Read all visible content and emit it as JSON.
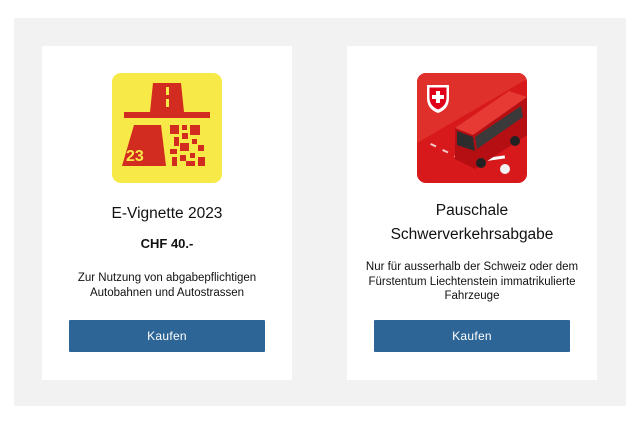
{
  "products": [
    {
      "title": "E-Vignette 2023",
      "price": "CHF 40.-",
      "description": "Zur Nutzung von abgabepflichtigen Autobahnen und Autostrassen",
      "button_label": "Kaufen",
      "icon_text": "23",
      "icon": "motorway-vignette-icon",
      "icon_bg": "#f7ea48",
      "icon_fg": "#d22b1f"
    },
    {
      "title_line1": "Pauschale",
      "title_line2": "Schwerverkehrsabgabe",
      "description": "Nur für ausserhalb der Schweiz oder dem Fürstentum Liechtenstein immatrikulierte Fahrzeuge",
      "button_label": "Kaufen",
      "icon": "swiss-heavy-vehicle-bus-icon",
      "icon_bg": "#d7191c"
    }
  ],
  "colors": {
    "button": "#2c6596",
    "panel": "#f2f2f2",
    "card": "#ffffff"
  }
}
